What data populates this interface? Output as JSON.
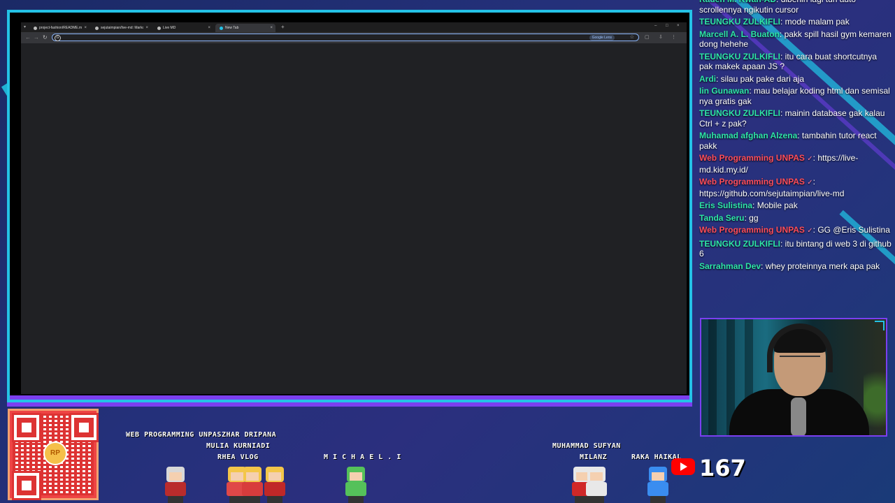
{
  "browser": {
    "tabs": [
      {
        "title": "project-fashion/README.md at ...",
        "active": false
      },
      {
        "title": "sejutaimpian/live-md: Markdo...",
        "active": false
      },
      {
        "title": "Live MD",
        "active": false
      },
      {
        "title": "New Tab",
        "active": true
      }
    ],
    "new_tab_symbol": "+",
    "omnibox_value": "",
    "lens_label": "Google Lens"
  },
  "chat": {
    "messages": [
      {
        "user": "Raden M. Kwan-AD",
        "user_color": "green",
        "text": "dibenin lagi tuh auto scrollennya ngikutin cursor"
      },
      {
        "user": "TEUNGKU ZULKIFLI",
        "user_color": "green",
        "text": "mode malam pak"
      },
      {
        "user": "Marcell A. L. Buaton",
        "user_color": "green",
        "text": "pakk spill hasil gym kemaren dong hehehe"
      },
      {
        "user": "TEUNGKU ZULKIFLI",
        "user_color": "green",
        "text": "itu cara buat shortcutnya pak makek apaan JS ?"
      },
      {
        "user": "Ardi",
        "user_color": "green",
        "text": "silau pak pake dari aja"
      },
      {
        "user": "Iin Gunawan",
        "user_color": "green",
        "text": "mau belajar koding html dan semisal nya gratis gak"
      },
      {
        "user": "TEUNGKU ZULKIFLI",
        "user_color": "green",
        "text": "mainin database gak kalau Ctrl + z pak?"
      },
      {
        "user": "Muhamad afghan Alzena",
        "user_color": "green",
        "text": "tambahin tutor react pakk"
      },
      {
        "user": "Web Programming UNPAS",
        "user_color": "red",
        "badge": "✓",
        "text": "https://live-md.kid.my.id/"
      },
      {
        "user": "Web Programming UNPAS",
        "user_color": "red",
        "badge": "✓",
        "text": "https://github.com/sejutaimpian/live-md"
      },
      {
        "user": "Eris Sulistina",
        "user_color": "green",
        "text": "Mobile pak"
      },
      {
        "user": "Tanda Seru",
        "user_color": "green",
        "text": "gg"
      },
      {
        "user": "Web Programming UNPAS",
        "user_color": "red",
        "badge": "✓",
        "text": "GG @Eris Sulistina"
      },
      {
        "user": "TEUNGKU ZULKIFLI",
        "user_color": "green",
        "text": "itu bintang di web 3 di github 6"
      },
      {
        "user": "Sarrahman Dev",
        "user_color": "green",
        "text": "whey proteinnya merk apa pak"
      }
    ]
  },
  "qr": {
    "logo_text": "RP"
  },
  "characters": [
    {
      "name": "WEB PROGRAMMING UNPAS",
      "color_head": "#d8d8d8",
      "color_torso": "#b92c2c"
    },
    {
      "name": "ZHAR DRIPANA",
      "color_head": "#f3c64a",
      "color_torso": "#e04848"
    },
    {
      "name": "MULIA KURNIADI",
      "color_head": "#f3c64a",
      "color_torso": "#d83c3c"
    },
    {
      "name": "RHEA VLOG",
      "color_head": "#f3c64a",
      "color_torso": "#c02828"
    },
    {
      "name": "M I C H A E L . I",
      "color_head": "#55c15a",
      "color_torso": "#55c15a"
    },
    {
      "name": "MUHAMMAD SUFYAN",
      "color_head": "#e8e8e8",
      "color_torso": "#d02828"
    },
    {
      "name": "MILANZ",
      "color_head": "#e8e8e8",
      "color_torso": "#e8e8e8"
    },
    {
      "name": "RAKA HAIKAL",
      "color_head": "#3a8df0",
      "color_torso": "#3a8df0"
    }
  ],
  "youtube": {
    "viewer_count": "167"
  },
  "colors": {
    "accent_cyan": "#24c2e6",
    "accent_purple": "#7b3ff0",
    "chat_green": "#2ee6a8",
    "chat_red": "#ff4d5a"
  }
}
